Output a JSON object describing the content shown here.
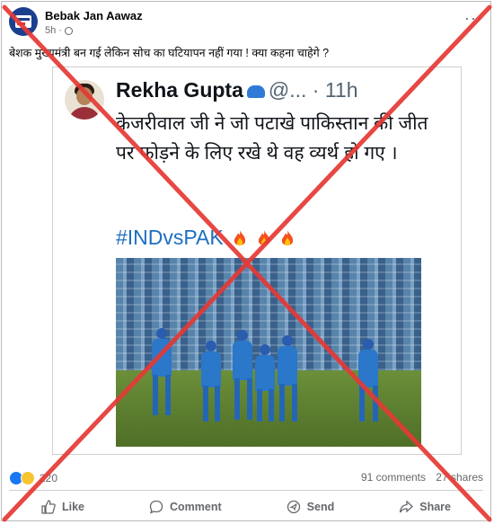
{
  "post": {
    "page_name": "Bebak Jan Aawaz",
    "time": "5h",
    "caption": "बेशक मुख्यमंत्री बन गई लेकिन सोच का घटियापन नहीं गया ! क्या कहना चाहेगे ?"
  },
  "tweet": {
    "name": "Rekha Gupta",
    "handle": "@...",
    "time": "· 11h",
    "text": "केजरीवाल जी ने जो पटाखे पाकिस्तान की जीत पर फोड़ने के लिए रखे थे वह व्यर्थ हो गए ।",
    "hashtag": "#INDvsPAK"
  },
  "stats": {
    "reactions_count": "220",
    "comments": "91 comments",
    "shares": "27 shares"
  },
  "actions": {
    "like": "Like",
    "comment": "Comment",
    "send": "Send",
    "share": "Share"
  },
  "icons": [
    "more-icon",
    "globe-icon",
    "verified-badge-icon",
    "fire-icon",
    "like-icon",
    "comment-icon",
    "send-icon",
    "share-icon"
  ],
  "colors": {
    "overlay_cross": "#e53935",
    "link_blue": "#1d6fc2",
    "fb_blue": "#1877f2"
  }
}
